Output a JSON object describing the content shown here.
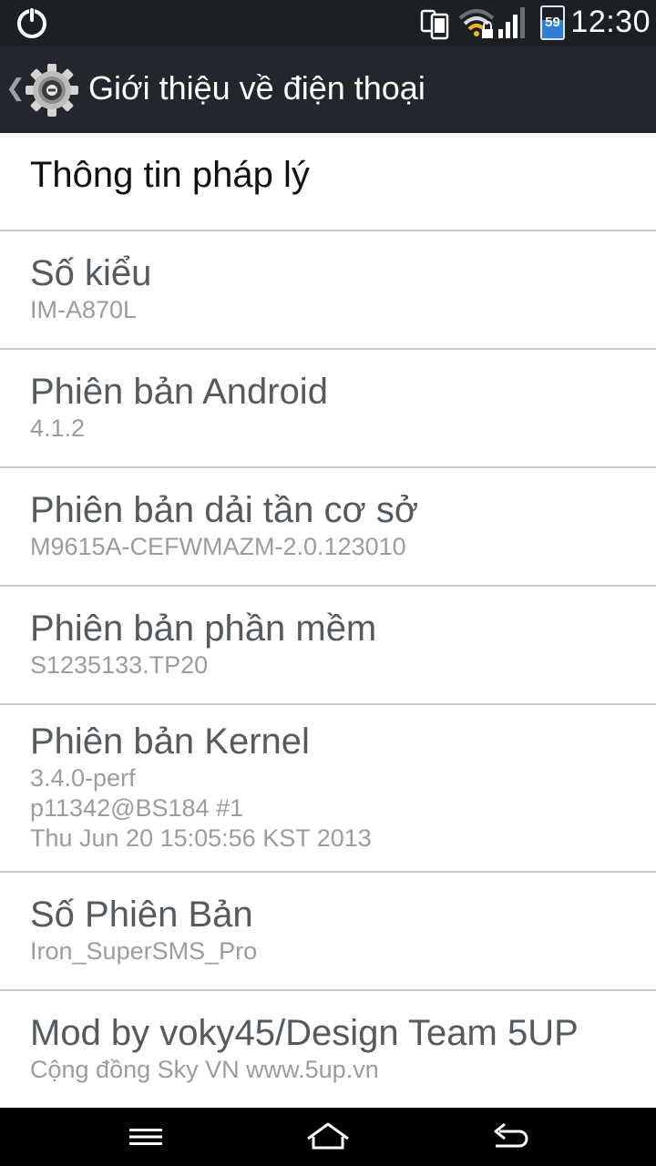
{
  "status_bar": {
    "battery_level": "59",
    "time": "12:30"
  },
  "action_bar": {
    "title": "Giới thiệu về  điện thoại"
  },
  "items": [
    {
      "label": "Thông tin pháp lý"
    },
    {
      "label": "Số kiểu",
      "value": "IM-A870L"
    },
    {
      "label": "Phiên bản Android",
      "value": "4.1.2"
    },
    {
      "label": "Phiên bản dải tần cơ sở",
      "value": "M9615A-CEFWMAZM-2.0.123010"
    },
    {
      "label": "Phiên bản phần mềm",
      "value": "S1235133.TP20"
    },
    {
      "label": "Phiên bản Kernel",
      "value_lines": [
        "3.4.0-perf",
        "p11342@BS184 #1",
        "Thu Jun 20 15:05:56 KST 2013"
      ]
    },
    {
      "label": "Số Phiên Bản",
      "value": "Iron_SuperSMS_Pro"
    },
    {
      "label": "Mod by voky45/Design Team 5UP",
      "value": "Cộng  đồng Sky VN www.5up.vn"
    }
  ],
  "icons": {
    "power": "power-icon",
    "dual_phone": "phone-sync-icon",
    "wifi": "wifi-lock-icon",
    "signal": "signal-icon",
    "battery": "battery-icon",
    "settings": "gear-icon",
    "menu": "menu-icon",
    "home": "home-icon",
    "back": "back-icon"
  },
  "colors": {
    "status_bar_bg": "#1c1f24",
    "action_bar_bg": "#23272d",
    "battery_fill": "#2f7fd6",
    "divider": "#c9c9c9",
    "primary_text": "#555a5f",
    "secondary_text": "#9a9da0"
  }
}
